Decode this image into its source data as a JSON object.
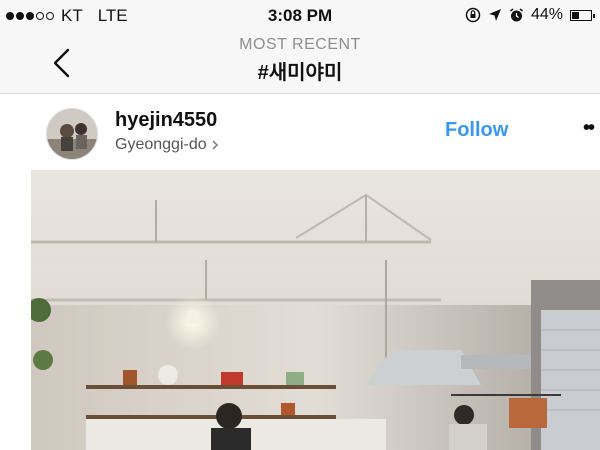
{
  "status_bar": {
    "carrier": "KT",
    "network": "LTE",
    "time": "3:08 PM",
    "battery_percent": "44%",
    "battery_level": 0.44,
    "signal_bars": 3,
    "signal_total": 5
  },
  "nav": {
    "subtitle": "MOST RECENT",
    "title": "#새미야미"
  },
  "post": {
    "username": "hyejin4550",
    "location": "Gyeonggi-do",
    "follow_label": "Follow",
    "more_label": "••"
  },
  "colors": {
    "accent": "#3897f0"
  }
}
